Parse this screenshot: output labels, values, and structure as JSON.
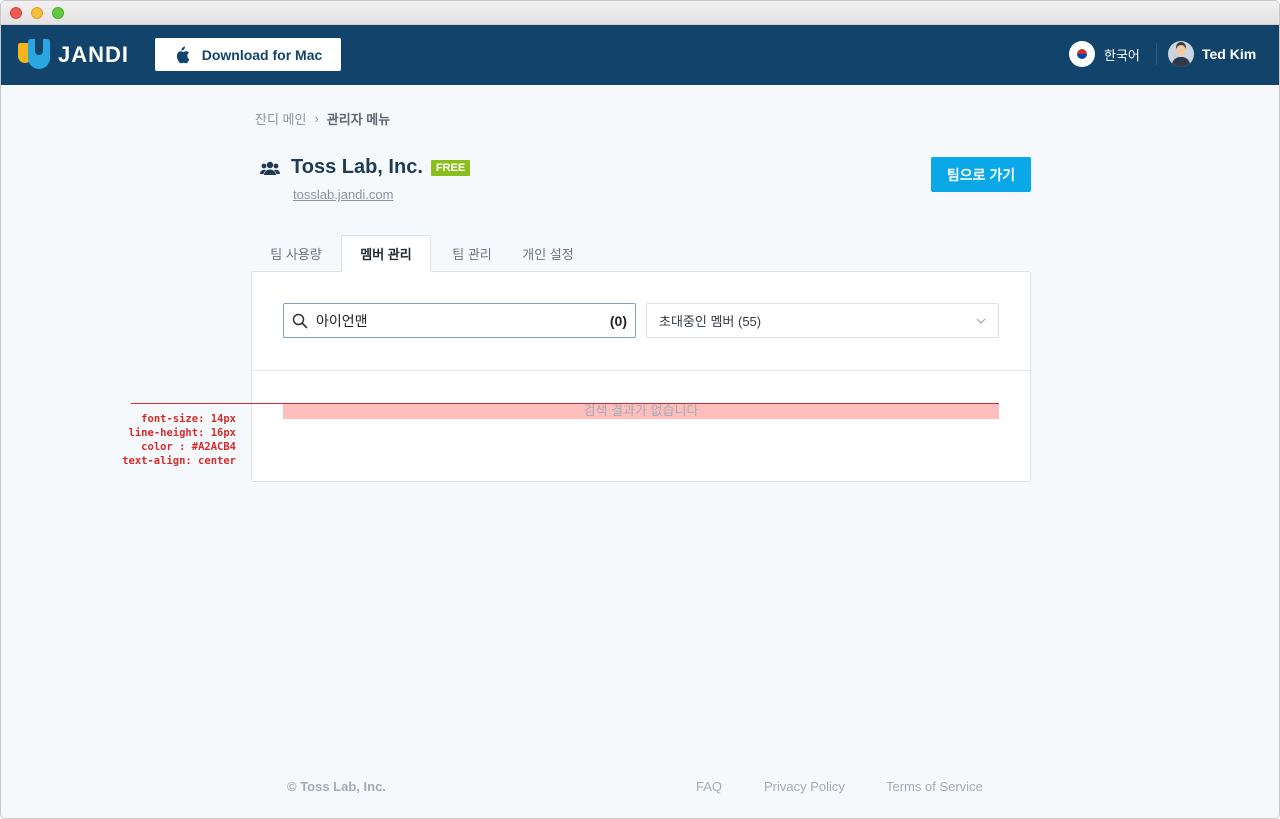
{
  "header": {
    "logo_text": "JANDI",
    "download_label": "Download for Mac",
    "language_label": "한국어",
    "user_name": "Ted Kim"
  },
  "breadcrumb": {
    "home": "잔디 메인",
    "separator": "›",
    "current": "관리자 메뉴"
  },
  "team": {
    "name": "Toss Lab, Inc.",
    "plan_badge": "FREE",
    "url": "tosslab.jandi.com",
    "go_team_label": "팀으로 가기"
  },
  "tabs": [
    {
      "label": "팀 사용량",
      "active": false
    },
    {
      "label": "멤버 관리",
      "active": true
    },
    {
      "label": "팀 관리",
      "active": false
    },
    {
      "label": "개인 설정",
      "active": false
    }
  ],
  "member_panel": {
    "search_value": "아이언맨",
    "search_count": "(0)",
    "filter_selected": "초대중인 멤버 (55)",
    "empty_message": "검색 결과가 없습니다"
  },
  "annotation": {
    "lines": [
      "font-size: 14px",
      "line-height: 16px",
      "color : #A2ACB4",
      "text-align: center"
    ]
  },
  "footer": {
    "copyright": "© Toss Lab, Inc.",
    "links": [
      "FAQ",
      "Privacy Policy",
      "Terms of Service"
    ]
  },
  "colors": {
    "topbar": "#12446b",
    "primary_button": "#0ba8e8",
    "free_badge": "#8bbd1f",
    "empty_text": "#A2ACB4",
    "annotation": "#d62b2b"
  },
  "icons": [
    "apple-icon",
    "korea-flag-icon",
    "avatar",
    "team-icon",
    "search-icon",
    "chevron-down-icon"
  ]
}
